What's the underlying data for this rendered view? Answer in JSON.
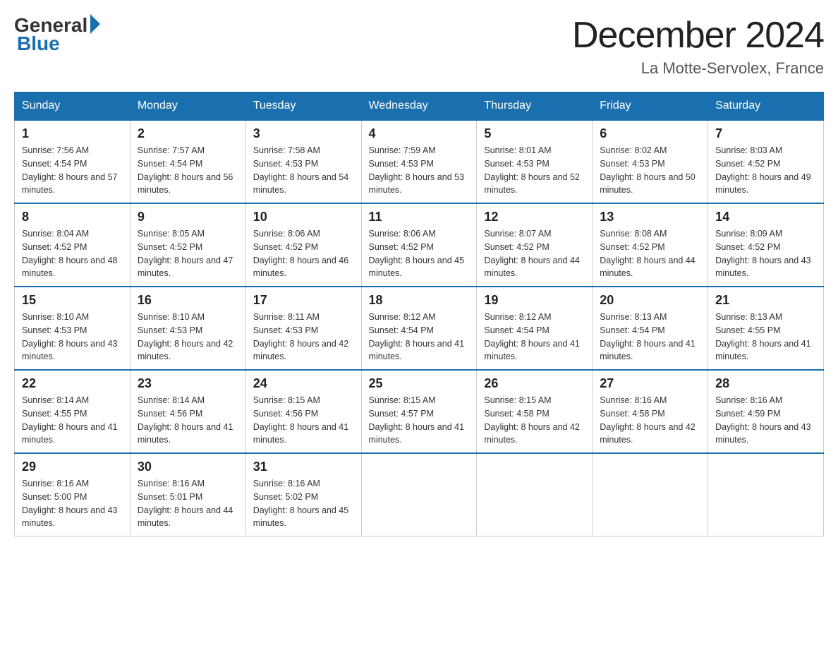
{
  "header": {
    "logo_general": "General",
    "logo_blue": "Blue",
    "month_title": "December 2024",
    "location": "La Motte-Servolex, France"
  },
  "weekdays": [
    "Sunday",
    "Monday",
    "Tuesday",
    "Wednesday",
    "Thursday",
    "Friday",
    "Saturday"
  ],
  "weeks": [
    [
      {
        "day": "1",
        "sunrise": "7:56 AM",
        "sunset": "4:54 PM",
        "daylight": "8 hours and 57 minutes."
      },
      {
        "day": "2",
        "sunrise": "7:57 AM",
        "sunset": "4:54 PM",
        "daylight": "8 hours and 56 minutes."
      },
      {
        "day": "3",
        "sunrise": "7:58 AM",
        "sunset": "4:53 PM",
        "daylight": "8 hours and 54 minutes."
      },
      {
        "day": "4",
        "sunrise": "7:59 AM",
        "sunset": "4:53 PM",
        "daylight": "8 hours and 53 minutes."
      },
      {
        "day": "5",
        "sunrise": "8:01 AM",
        "sunset": "4:53 PM",
        "daylight": "8 hours and 52 minutes."
      },
      {
        "day": "6",
        "sunrise": "8:02 AM",
        "sunset": "4:53 PM",
        "daylight": "8 hours and 50 minutes."
      },
      {
        "day": "7",
        "sunrise": "8:03 AM",
        "sunset": "4:52 PM",
        "daylight": "8 hours and 49 minutes."
      }
    ],
    [
      {
        "day": "8",
        "sunrise": "8:04 AM",
        "sunset": "4:52 PM",
        "daylight": "8 hours and 48 minutes."
      },
      {
        "day": "9",
        "sunrise": "8:05 AM",
        "sunset": "4:52 PM",
        "daylight": "8 hours and 47 minutes."
      },
      {
        "day": "10",
        "sunrise": "8:06 AM",
        "sunset": "4:52 PM",
        "daylight": "8 hours and 46 minutes."
      },
      {
        "day": "11",
        "sunrise": "8:06 AM",
        "sunset": "4:52 PM",
        "daylight": "8 hours and 45 minutes."
      },
      {
        "day": "12",
        "sunrise": "8:07 AM",
        "sunset": "4:52 PM",
        "daylight": "8 hours and 44 minutes."
      },
      {
        "day": "13",
        "sunrise": "8:08 AM",
        "sunset": "4:52 PM",
        "daylight": "8 hours and 44 minutes."
      },
      {
        "day": "14",
        "sunrise": "8:09 AM",
        "sunset": "4:52 PM",
        "daylight": "8 hours and 43 minutes."
      }
    ],
    [
      {
        "day": "15",
        "sunrise": "8:10 AM",
        "sunset": "4:53 PM",
        "daylight": "8 hours and 43 minutes."
      },
      {
        "day": "16",
        "sunrise": "8:10 AM",
        "sunset": "4:53 PM",
        "daylight": "8 hours and 42 minutes."
      },
      {
        "day": "17",
        "sunrise": "8:11 AM",
        "sunset": "4:53 PM",
        "daylight": "8 hours and 42 minutes."
      },
      {
        "day": "18",
        "sunrise": "8:12 AM",
        "sunset": "4:54 PM",
        "daylight": "8 hours and 41 minutes."
      },
      {
        "day": "19",
        "sunrise": "8:12 AM",
        "sunset": "4:54 PM",
        "daylight": "8 hours and 41 minutes."
      },
      {
        "day": "20",
        "sunrise": "8:13 AM",
        "sunset": "4:54 PM",
        "daylight": "8 hours and 41 minutes."
      },
      {
        "day": "21",
        "sunrise": "8:13 AM",
        "sunset": "4:55 PM",
        "daylight": "8 hours and 41 minutes."
      }
    ],
    [
      {
        "day": "22",
        "sunrise": "8:14 AM",
        "sunset": "4:55 PM",
        "daylight": "8 hours and 41 minutes."
      },
      {
        "day": "23",
        "sunrise": "8:14 AM",
        "sunset": "4:56 PM",
        "daylight": "8 hours and 41 minutes."
      },
      {
        "day": "24",
        "sunrise": "8:15 AM",
        "sunset": "4:56 PM",
        "daylight": "8 hours and 41 minutes."
      },
      {
        "day": "25",
        "sunrise": "8:15 AM",
        "sunset": "4:57 PM",
        "daylight": "8 hours and 41 minutes."
      },
      {
        "day": "26",
        "sunrise": "8:15 AM",
        "sunset": "4:58 PM",
        "daylight": "8 hours and 42 minutes."
      },
      {
        "day": "27",
        "sunrise": "8:16 AM",
        "sunset": "4:58 PM",
        "daylight": "8 hours and 42 minutes."
      },
      {
        "day": "28",
        "sunrise": "8:16 AM",
        "sunset": "4:59 PM",
        "daylight": "8 hours and 43 minutes."
      }
    ],
    [
      {
        "day": "29",
        "sunrise": "8:16 AM",
        "sunset": "5:00 PM",
        "daylight": "8 hours and 43 minutes."
      },
      {
        "day": "30",
        "sunrise": "8:16 AM",
        "sunset": "5:01 PM",
        "daylight": "8 hours and 44 minutes."
      },
      {
        "day": "31",
        "sunrise": "8:16 AM",
        "sunset": "5:02 PM",
        "daylight": "8 hours and 45 minutes."
      },
      null,
      null,
      null,
      null
    ]
  ],
  "labels": {
    "sunrise": "Sunrise:",
    "sunset": "Sunset:",
    "daylight": "Daylight:"
  }
}
